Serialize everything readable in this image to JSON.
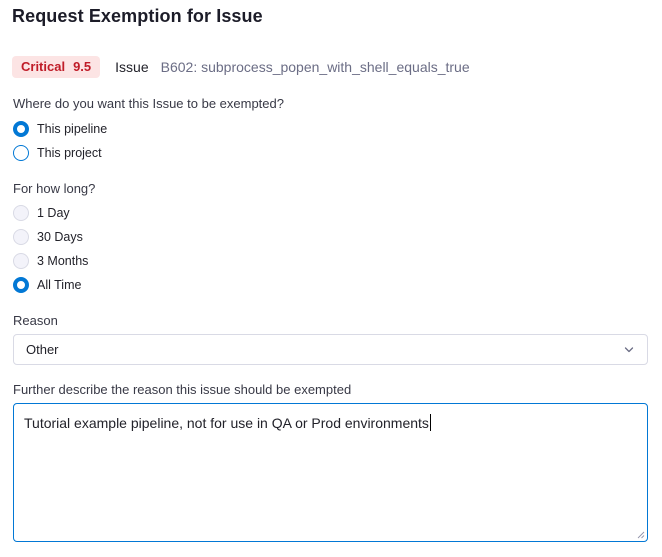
{
  "dialog": {
    "title": "Request Exemption for Issue"
  },
  "issue": {
    "severity_label": "Critical",
    "severity_score": "9.5",
    "label": "Issue",
    "name": "B602: subprocess_popen_with_shell_equals_true"
  },
  "scope": {
    "question": "Where do you want this Issue to be exempted?",
    "options": [
      {
        "label": "This pipeline",
        "selected": true
      },
      {
        "label": "This project",
        "selected": false
      }
    ]
  },
  "duration": {
    "question": "For how long?",
    "options": [
      {
        "label": "1 Day",
        "selected": false
      },
      {
        "label": "30 Days",
        "selected": false
      },
      {
        "label": "3 Months",
        "selected": false
      },
      {
        "label": "All Time",
        "selected": true
      }
    ]
  },
  "reason": {
    "label": "Reason",
    "selected_value": "Other"
  },
  "description": {
    "label": "Further describe the reason this issue should be exempted",
    "value": "Tutorial example pipeline, not for use in QA or Prod environments"
  },
  "colors": {
    "accent": "#0278d5",
    "critical_text": "#c01c28",
    "critical_bg": "#fce4e4"
  }
}
